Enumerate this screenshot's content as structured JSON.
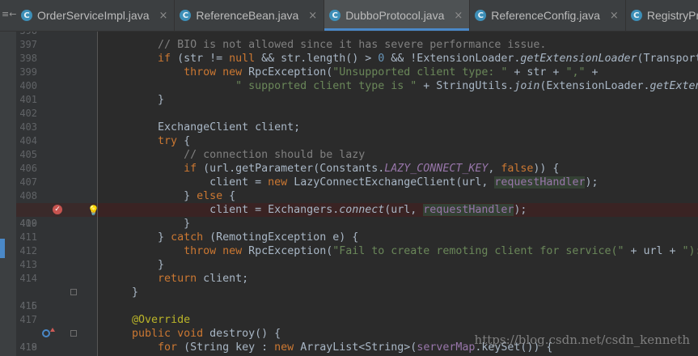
{
  "tabs": [
    {
      "label": "OrderServiceImpl.java",
      "icon": "class-icon",
      "active": false
    },
    {
      "label": "ReferenceBean.java",
      "icon": "class-icon",
      "active": false
    },
    {
      "label": "DubboProtocol.java",
      "icon": "class-icon",
      "active": true
    },
    {
      "label": "ReferenceConfig.java",
      "icon": "class-icon",
      "active": false
    },
    {
      "label": "RegistryProtocol.jav",
      "icon": "class-icon",
      "active": false
    }
  ],
  "tab_close_glyph": "×",
  "left_stub_glyph": "≡←",
  "lines": [
    {
      "num": "396"
    },
    {
      "num": "397"
    },
    {
      "num": "398"
    },
    {
      "num": "399"
    },
    {
      "num": "400"
    },
    {
      "num": "401"
    },
    {
      "num": "402"
    },
    {
      "num": "403"
    },
    {
      "num": "404"
    },
    {
      "num": "405"
    },
    {
      "num": "406"
    },
    {
      "num": "407"
    },
    {
      "num": "408"
    },
    {
      "num": "409"
    },
    {
      "num": "410"
    },
    {
      "num": "411"
    },
    {
      "num": "412"
    },
    {
      "num": "413"
    },
    {
      "num": "414"
    },
    {
      "num": "415"
    },
    {
      "num": "416"
    },
    {
      "num": "417"
    },
    {
      "num": "418"
    },
    {
      "num": "419"
    }
  ],
  "code": {
    "l397_comment": "// BIO is not allowed since it has severe performance issue.",
    "l398_if": "if",
    "l398_a": " (str != ",
    "l398_null": "null",
    "l398_b": " && str.length() > ",
    "l398_zero": "0",
    "l398_c": " && !ExtensionLoader.",
    "l398_method": "getExtensionLoader",
    "l398_d": "(Transporter.",
    "l398_e": "c",
    "l399_throw": "throw",
    "l399_new": "new",
    "l399_a": " RpcException(",
    "l399_str1": "\"Unsupported client type: \"",
    "l399_b": " + str + ",
    "l399_str2": "\",\"",
    "l399_c": " +",
    "l400_str": "\" supported client type is \"",
    "l400_a": " + StringUtils.",
    "l400_join": "join",
    "l400_b": "(ExtensionLoader.",
    "l400_get": "getExtension",
    "brace_close": "}",
    "l403_a": "ExchangeClient client;",
    "l404_try": "try",
    "l404_b": " {",
    "l405_comment": "// connection should be lazy",
    "l406_if": "if",
    "l406_a": " (url.getParameter(Constants.",
    "l406_const": "LAZY_CONNECT_KEY",
    "l406_b": ", ",
    "l406_false": "false",
    "l406_c": ")) {",
    "l407_a": "client = ",
    "l407_new": "new",
    "l407_b": " LazyConnectExchangeClient(url, ",
    "l407_var": "requestHandler",
    "l407_c": ");",
    "l408_a": "} ",
    "l408_else": "else",
    "l408_b": " {",
    "l409_a": "client = Exchangers.",
    "l409_connect": "connect",
    "l409_b": "(url, ",
    "l409_var": "requestHandler",
    "l409_c": ");",
    "l411_a": "} ",
    "l411_catch": "catch",
    "l411_b": " (RemotingException e) {",
    "l412_throw": "throw",
    "l412_new": "new",
    "l412_a": " RpcException(",
    "l412_str": "\"Fail to create remoting client for service(\"",
    "l412_b": " + url + ",
    "l412_str2": "\"): \"",
    "l412_c": " +",
    "l414_return": "return",
    "l414_a": " client;",
    "l417_ann": "@Override",
    "l418_public": "public",
    "l418_void": "void",
    "l418_a": " destroy() {",
    "l419_for": "for",
    "l419_a": " (String key : ",
    "l419_new": "new",
    "l419_b": " ArrayList<String>(",
    "l419_field": "serverMap",
    "l419_c": ".keySet()) {"
  },
  "watermark": "https://blog.csdn.net/csdn_kenneth",
  "colors": {
    "background": "#2b2b2b",
    "keyword": "#cc7832",
    "string": "#6a8759",
    "comment": "#808080",
    "number": "#6897bb",
    "field": "#9876aa",
    "annotation": "#bbb529",
    "breakpoint": "#c75450",
    "active_tab_underline": "#4a88c7"
  }
}
